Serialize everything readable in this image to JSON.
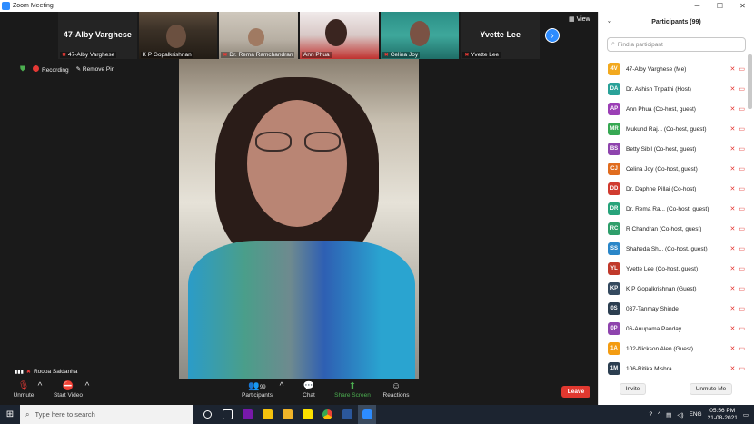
{
  "window": {
    "title": "Zoom Meeting",
    "controls": [
      "─",
      "☐",
      "✕"
    ]
  },
  "view": {
    "label": "View"
  },
  "strip": [
    {
      "big": "47-Alby Varghese",
      "label": "47-Alby Varghese",
      "style": "dark"
    },
    {
      "big": "",
      "label": "K P Gopalkrishnan",
      "style": "photo1"
    },
    {
      "big": "",
      "label": "Dr. Rema Ramchandran",
      "style": "photo2"
    },
    {
      "big": "",
      "label": "Ann Phua",
      "style": "photo3"
    },
    {
      "big": "",
      "label": "Celina Joy",
      "style": "photo4"
    },
    {
      "big": "Yvette Lee",
      "label": "Yvette Lee",
      "style": "dark"
    }
  ],
  "status": {
    "recording": "Recording",
    "remove_pin": "Remove Pin"
  },
  "speaker": {
    "name": "Roopa Saldanha"
  },
  "toolbar": {
    "unmute": "Unmute",
    "start_video": "Start Video",
    "participants": "Participants",
    "participants_count": "99",
    "chat": "Chat",
    "share_screen": "Share Screen",
    "reactions": "Reactions",
    "leave": "Leave"
  },
  "panel": {
    "title": "Participants (99)",
    "search_placeholder": "Find a participant",
    "invite": "Invite",
    "unmute_me": "Unmute Me",
    "participants": [
      {
        "initials": "4V",
        "name": "47-Alby Varghese (Me)",
        "color": "#f2a91f"
      },
      {
        "initials": "DA",
        "name": "Dr. Ashish Tripathi (Host)",
        "color": "#2aa198"
      },
      {
        "initials": "AP",
        "name": "Ann Phua (Co-host, guest)",
        "color": "#9b3fb5"
      },
      {
        "initials": "MR",
        "name": "Mukund Raj... (Co-host, guest)",
        "color": "#36a852"
      },
      {
        "initials": "BS",
        "name": "Betty Sibil (Co-host, guest)",
        "color": "#8e44ad"
      },
      {
        "initials": "CJ",
        "name": "Celina Joy (Co-host, guest)",
        "color": "#e06c1f"
      },
      {
        "initials": "DD",
        "name": "Dr. Daphne Pillai (Co-host)",
        "color": "#d03b2f"
      },
      {
        "initials": "DR",
        "name": "Dr. Rema Ra... (Co-host, guest)",
        "color": "#27a37a"
      },
      {
        "initials": "RC",
        "name": "R Chandran (Co-host, guest)",
        "color": "#2e9e6a"
      },
      {
        "initials": "SS",
        "name": "Shaheda Sh... (Co-host, guest)",
        "color": "#2a86c8"
      },
      {
        "initials": "YL",
        "name": "Yvette Lee (Co-host, guest)",
        "color": "#c0392b"
      },
      {
        "initials": "KP",
        "name": "K P Gopalkrishnan (Guest)",
        "color": "#34495e"
      },
      {
        "initials": "0S",
        "name": "037-Tanmay Shinde",
        "color": "#2c3e50"
      },
      {
        "initials": "0P",
        "name": "06-Anupama Panday",
        "color": "#8e44ad"
      },
      {
        "initials": "1A",
        "name": "102-Nickson Alen (Guest)",
        "color": "#f39c12"
      },
      {
        "initials": "1M",
        "name": "106-Ritika Mishra",
        "color": "#2c3e50"
      }
    ]
  },
  "taskbar": {
    "search_placeholder": "Type here to search",
    "lang": "ENG",
    "time": "05:56 PM",
    "date": "21-08-2021"
  }
}
